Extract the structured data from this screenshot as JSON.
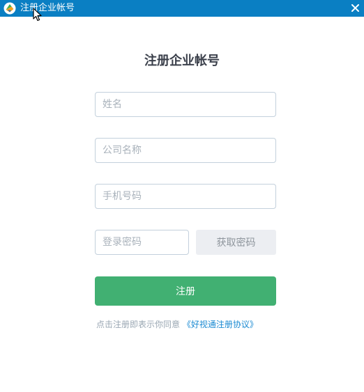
{
  "window": {
    "title": "注册企业帐号",
    "titlebar_color": "#0a7fc3",
    "app_icon": "app-logo-icon",
    "close_icon": "close-icon"
  },
  "form": {
    "heading": "注册企业帐号",
    "name_placeholder": "姓名",
    "company_placeholder": "公司名称",
    "phone_placeholder": "手机号码",
    "password_placeholder": "登录密码",
    "get_password_label": "获取密码",
    "submit_label": "注册",
    "accent_color": "#41b072"
  },
  "agreement": {
    "prefix": "点击注册即表示你同意",
    "link_text": "《好视通注册协议》",
    "link_color": "#1a8ad2"
  }
}
